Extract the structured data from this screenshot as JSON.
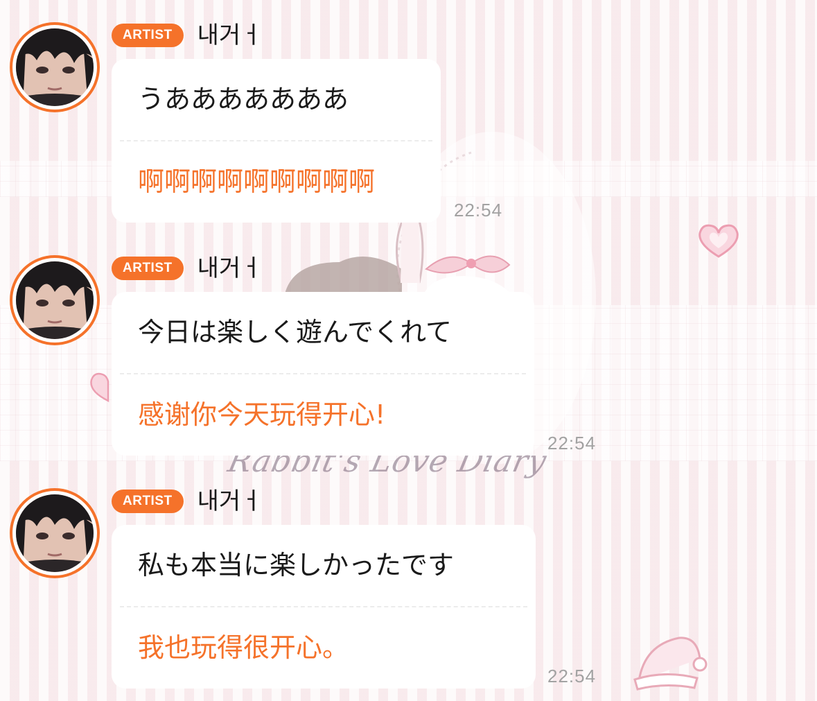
{
  "messages": [
    {
      "badge": "ARTIST",
      "username": "내거ㅓ",
      "original": "うあああああああ",
      "translation": "啊啊啊啊啊啊啊啊啊",
      "time": "22:54"
    },
    {
      "badge": "ARTIST",
      "username": "내거ㅓ",
      "original": "今日は楽しく遊んでくれて",
      "translation": "感谢你今天玩得开心!",
      "time": "22:54"
    },
    {
      "badge": "ARTIST",
      "username": "내거ㅓ",
      "original": "私も本当に楽しかったです",
      "translation": "我也玩得很开心。",
      "time": "22:54"
    }
  ],
  "background": {
    "watermark_text": "Rabbit's Love Diary"
  },
  "colors": {
    "accent": "#f5722a",
    "bubble": "#ffffff",
    "text": "#1a1a1a",
    "timestamp": "#a2a2a2",
    "background": "#fbf3f4"
  },
  "icons": {
    "avatar": "profile-photo",
    "background": "pink-striped-rabbit-wallpaper"
  }
}
